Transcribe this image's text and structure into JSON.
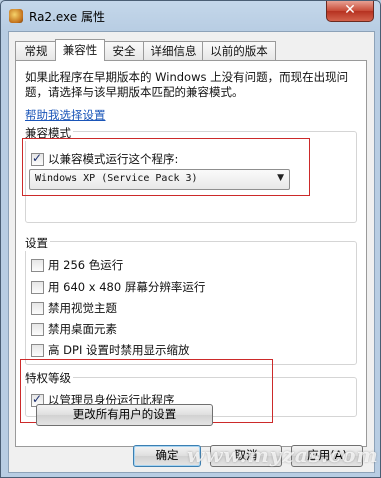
{
  "window": {
    "title": "Ra2.exe 属性",
    "close_glyph": "✕"
  },
  "tabs": [
    {
      "label": "常规"
    },
    {
      "label": "兼容性",
      "active": true
    },
    {
      "label": "安全"
    },
    {
      "label": "详细信息"
    },
    {
      "label": "以前的版本"
    }
  ],
  "intro": "如果此程序在早期版本的 Windows 上没有问题，而现在出现问题，请选择与该早期版本匹配的兼容模式。",
  "help_link": "帮助我选择设置",
  "compat_mode": {
    "title": "兼容模式",
    "checkbox_label": "以兼容模式运行这个程序:",
    "checked": true,
    "selected_os": "Windows XP (Service Pack 3)"
  },
  "settings": {
    "title": "设置",
    "items": [
      {
        "label": "用 256 色运行",
        "checked": false
      },
      {
        "label": "用 640 x 480 屏幕分辨率运行",
        "checked": false
      },
      {
        "label": "禁用视觉主题",
        "checked": false
      },
      {
        "label": "禁用桌面元素",
        "checked": false
      },
      {
        "label": "高 DPI 设置时禁用显示缩放",
        "checked": false
      }
    ]
  },
  "privilege": {
    "title": "特权等级",
    "checkbox_label": "以管理员身份运行此程序",
    "checked": true
  },
  "buttons": {
    "all_users": "更改所有用户的设置",
    "ok": "确定",
    "cancel": "取消",
    "apply": "应用(A)"
  },
  "watermark": "www.myzas.com",
  "colors": {
    "highlight_box": "#cc2a2a",
    "link": "#1a55b8"
  }
}
